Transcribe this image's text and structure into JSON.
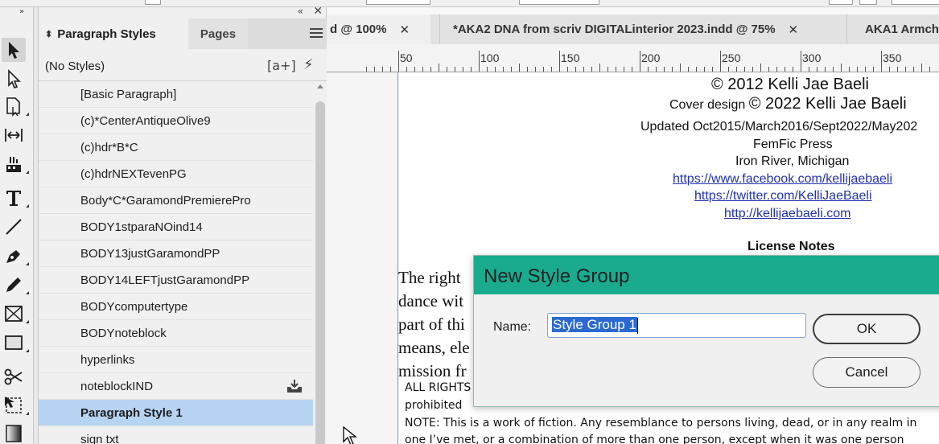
{
  "paragraph_styles_panel": {
    "tab_active": "Paragraph Styles",
    "tab_inactive": "Pages",
    "no_styles": "(No Styles)",
    "styles": [
      "[Basic Paragraph]",
      "(c)*CenterAntiqueOlive9",
      "(c)hdr*B*C",
      "(c)hdrNEXTevenPG",
      "Body*C*GaramondPremierePro",
      "BODY1stparaNOind14",
      "BODY13justGaramondPP",
      "BODY14LEFTjustGaramondPP",
      "BODYcomputertype",
      "BODYnoteblock",
      "hyperlinks",
      "noteblockIND",
      "Paragraph Style 1",
      "sign txt"
    ],
    "selected_style": "Paragraph Style 1"
  },
  "document_tabs": [
    {
      "label": "d @ 100%",
      "active": true
    },
    {
      "label": "*AKA2 DNA from scriv DIGITALinterior 2023.indd @ 75%",
      "active": false
    },
    {
      "label": "AKA1 Armch",
      "active": false
    }
  ],
  "ruler": {
    "labels": [
      "50",
      "100",
      "150",
      "200",
      "250",
      "300",
      "350"
    ]
  },
  "page_text": {
    "copyright_line": "© 2012 Kelli Jae Baeli",
    "cover_prefix": "Cover design ",
    "cover_line": "© 2022 Kelli Jae Baeli",
    "updated_line": "Updated Oct2015/March2016/Sept2022/May202",
    "press": "FemFic Press",
    "location": "Iron River, Michigan",
    "facebook_link": "https://www.facebook.com/kellijaebaeli",
    "twitter_link": "https://twitter.com/KelliJaeBaeli",
    "site_link": "http://kellijaebaeli.com",
    "license_heading": "License Notes",
    "serif_lines": [
      "The right",
      "dance wit",
      "part of thi",
      "means, ele",
      "mission fr"
    ],
    "rights_line": "ALL RIGHTS",
    "prohibited_line": "prohibited",
    "note_line1": "NOTE: This is a work of fiction. Any resemblance to persons living, dead, or in any realm in",
    "note_line2": "one I’ve met, or a combination of more than one person, except when it was one person"
  },
  "dialog": {
    "title": "New Style Group",
    "name_label": "Name:",
    "name_value": "Style Group 1",
    "ok_label": "OK",
    "cancel_label": "Cancel",
    "title_color": "#1aab8f"
  },
  "colors": {
    "selection": "#b7d3f2",
    "link": "#2233aa",
    "text_highlight": "#2a6ad0"
  }
}
